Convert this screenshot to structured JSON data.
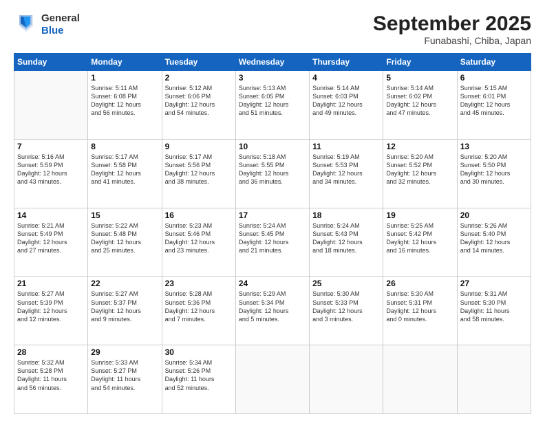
{
  "logo": {
    "line1": "General",
    "line2": "Blue"
  },
  "title": "September 2025",
  "location": "Funabashi, Chiba, Japan",
  "weekdays": [
    "Sunday",
    "Monday",
    "Tuesday",
    "Wednesday",
    "Thursday",
    "Friday",
    "Saturday"
  ],
  "weeks": [
    [
      {
        "day": "",
        "info": ""
      },
      {
        "day": "1",
        "info": "Sunrise: 5:11 AM\nSunset: 6:08 PM\nDaylight: 12 hours\nand 56 minutes."
      },
      {
        "day": "2",
        "info": "Sunrise: 5:12 AM\nSunset: 6:06 PM\nDaylight: 12 hours\nand 54 minutes."
      },
      {
        "day": "3",
        "info": "Sunrise: 5:13 AM\nSunset: 6:05 PM\nDaylight: 12 hours\nand 51 minutes."
      },
      {
        "day": "4",
        "info": "Sunrise: 5:14 AM\nSunset: 6:03 PM\nDaylight: 12 hours\nand 49 minutes."
      },
      {
        "day": "5",
        "info": "Sunrise: 5:14 AM\nSunset: 6:02 PM\nDaylight: 12 hours\nand 47 minutes."
      },
      {
        "day": "6",
        "info": "Sunrise: 5:15 AM\nSunset: 6:01 PM\nDaylight: 12 hours\nand 45 minutes."
      }
    ],
    [
      {
        "day": "7",
        "info": "Sunrise: 5:16 AM\nSunset: 5:59 PM\nDaylight: 12 hours\nand 43 minutes."
      },
      {
        "day": "8",
        "info": "Sunrise: 5:17 AM\nSunset: 5:58 PM\nDaylight: 12 hours\nand 41 minutes."
      },
      {
        "day": "9",
        "info": "Sunrise: 5:17 AM\nSunset: 5:56 PM\nDaylight: 12 hours\nand 38 minutes."
      },
      {
        "day": "10",
        "info": "Sunrise: 5:18 AM\nSunset: 5:55 PM\nDaylight: 12 hours\nand 36 minutes."
      },
      {
        "day": "11",
        "info": "Sunrise: 5:19 AM\nSunset: 5:53 PM\nDaylight: 12 hours\nand 34 minutes."
      },
      {
        "day": "12",
        "info": "Sunrise: 5:20 AM\nSunset: 5:52 PM\nDaylight: 12 hours\nand 32 minutes."
      },
      {
        "day": "13",
        "info": "Sunrise: 5:20 AM\nSunset: 5:50 PM\nDaylight: 12 hours\nand 30 minutes."
      }
    ],
    [
      {
        "day": "14",
        "info": "Sunrise: 5:21 AM\nSunset: 5:49 PM\nDaylight: 12 hours\nand 27 minutes."
      },
      {
        "day": "15",
        "info": "Sunrise: 5:22 AM\nSunset: 5:48 PM\nDaylight: 12 hours\nand 25 minutes."
      },
      {
        "day": "16",
        "info": "Sunrise: 5:23 AM\nSunset: 5:46 PM\nDaylight: 12 hours\nand 23 minutes."
      },
      {
        "day": "17",
        "info": "Sunrise: 5:24 AM\nSunset: 5:45 PM\nDaylight: 12 hours\nand 21 minutes."
      },
      {
        "day": "18",
        "info": "Sunrise: 5:24 AM\nSunset: 5:43 PM\nDaylight: 12 hours\nand 18 minutes."
      },
      {
        "day": "19",
        "info": "Sunrise: 5:25 AM\nSunset: 5:42 PM\nDaylight: 12 hours\nand 16 minutes."
      },
      {
        "day": "20",
        "info": "Sunrise: 5:26 AM\nSunset: 5:40 PM\nDaylight: 12 hours\nand 14 minutes."
      }
    ],
    [
      {
        "day": "21",
        "info": "Sunrise: 5:27 AM\nSunset: 5:39 PM\nDaylight: 12 hours\nand 12 minutes."
      },
      {
        "day": "22",
        "info": "Sunrise: 5:27 AM\nSunset: 5:37 PM\nDaylight: 12 hours\nand 9 minutes."
      },
      {
        "day": "23",
        "info": "Sunrise: 5:28 AM\nSunset: 5:36 PM\nDaylight: 12 hours\nand 7 minutes."
      },
      {
        "day": "24",
        "info": "Sunrise: 5:29 AM\nSunset: 5:34 PM\nDaylight: 12 hours\nand 5 minutes."
      },
      {
        "day": "25",
        "info": "Sunrise: 5:30 AM\nSunset: 5:33 PM\nDaylight: 12 hours\nand 3 minutes."
      },
      {
        "day": "26",
        "info": "Sunrise: 5:30 AM\nSunset: 5:31 PM\nDaylight: 12 hours\nand 0 minutes."
      },
      {
        "day": "27",
        "info": "Sunrise: 5:31 AM\nSunset: 5:30 PM\nDaylight: 11 hours\nand 58 minutes."
      }
    ],
    [
      {
        "day": "28",
        "info": "Sunrise: 5:32 AM\nSunset: 5:28 PM\nDaylight: 11 hours\nand 56 minutes."
      },
      {
        "day": "29",
        "info": "Sunrise: 5:33 AM\nSunset: 5:27 PM\nDaylight: 11 hours\nand 54 minutes."
      },
      {
        "day": "30",
        "info": "Sunrise: 5:34 AM\nSunset: 5:26 PM\nDaylight: 11 hours\nand 52 minutes."
      },
      {
        "day": "",
        "info": ""
      },
      {
        "day": "",
        "info": ""
      },
      {
        "day": "",
        "info": ""
      },
      {
        "day": "",
        "info": ""
      }
    ]
  ]
}
